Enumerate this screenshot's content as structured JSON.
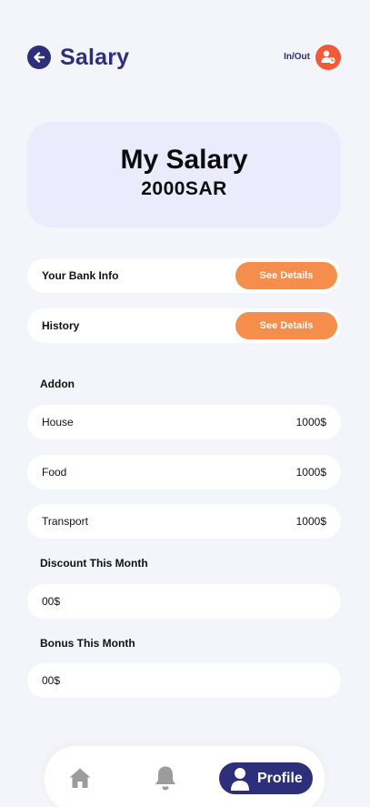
{
  "header": {
    "title": "Salary",
    "inout_label": "In/Out"
  },
  "salary_card": {
    "title": "My Salary",
    "amount": "2000SAR"
  },
  "bank_info": {
    "label": "Your Bank Info",
    "button": "See Details"
  },
  "history": {
    "label": "History",
    "button": "See Details"
  },
  "addon": {
    "title": "Addon",
    "items": [
      {
        "label": "House",
        "value": "1000$"
      },
      {
        "label": "Food",
        "value": "1000$"
      },
      {
        "label": "Transport",
        "value": "1000$"
      }
    ]
  },
  "discount": {
    "title": "Discount This Month",
    "value": "00$"
  },
  "bonus": {
    "title": "Bonus This Month",
    "value": "00$"
  },
  "nav": {
    "items": [
      {
        "icon": "home-icon"
      },
      {
        "icon": "bell-icon"
      },
      {
        "icon": "profile-icon",
        "label": "Profile",
        "active": true
      }
    ]
  },
  "colors": {
    "brand": "#2e2f7a",
    "accent": "#f58d4c",
    "inout": "#f05a38",
    "card": "#ecebfd",
    "background": "#f4f4fb"
  }
}
